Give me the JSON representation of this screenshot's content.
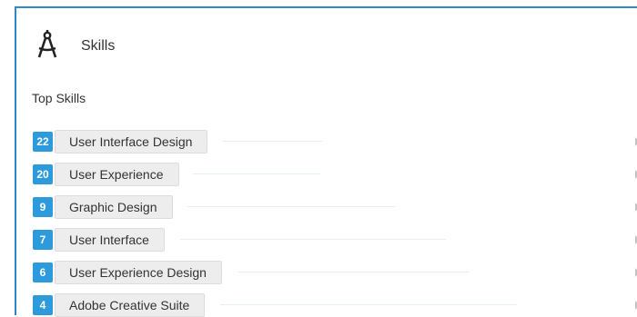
{
  "section": {
    "title": "Skills",
    "icon": "compass-drafting-icon",
    "subheading": "Top Skills"
  },
  "skills": [
    {
      "count": "22",
      "name": "User Interface Design"
    },
    {
      "count": "20",
      "name": "User Experience"
    },
    {
      "count": "9",
      "name": "Graphic Design"
    },
    {
      "count": "7",
      "name": "User Interface"
    },
    {
      "count": "6",
      "name": "User Experience Design"
    },
    {
      "count": "4",
      "name": "Adobe Creative Suite"
    }
  ],
  "colors": {
    "accent": "#2c9adb",
    "frame": "#2f86c8"
  }
}
